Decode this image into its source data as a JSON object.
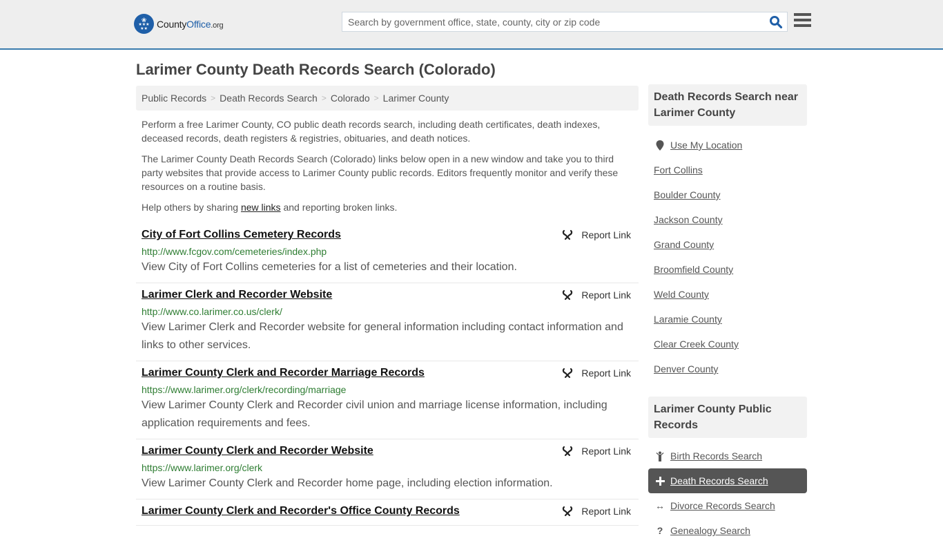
{
  "header": {
    "logo": {
      "county": "County",
      "office": "Office",
      "org": ".org"
    },
    "search_placeholder": "Search by government office, state, county, city or zip code",
    "search_value": ""
  },
  "page": {
    "title": "Larimer County Death Records Search (Colorado)",
    "breadcrumb": [
      "Public Records",
      "Death Records Search",
      "Colorado",
      "Larimer County"
    ],
    "intro": {
      "p1": "Perform a free Larimer County, CO public death records search, including death certificates, death indexes, deceased records, death registers & registries, obituaries, and death notices.",
      "p2": "The Larimer County Death Records Search (Colorado) links below open in a new window and take you to third party websites that provide access to Larimer County public records. Editors frequently monitor and verify these resources on a routine basis.",
      "p3_before": "Help others by sharing ",
      "p3_link": "new links",
      "p3_after": " and reporting broken links."
    }
  },
  "results": [
    {
      "title": "City of Fort Collins Cemetery Records",
      "url": "http://www.fcgov.com/cemeteries/index.php",
      "description": "View City of Fort Collins cemeteries for a list of cemeteries and their location.",
      "report": "Report Link"
    },
    {
      "title": "Larimer Clerk and Recorder Website",
      "url": "http://www.co.larimer.co.us/clerk/",
      "description": "View Larimer Clerk and Recorder website for general information including contact information and links to other services.",
      "report": "Report Link"
    },
    {
      "title": "Larimer County Clerk and Recorder Marriage Records",
      "url": "https://www.larimer.org/clerk/recording/marriage",
      "description": "View Larimer County Clerk and Recorder civil union and marriage license information, including application requirements and fees.",
      "report": "Report Link"
    },
    {
      "title": "Larimer County Clerk and Recorder Website",
      "url": "https://www.larimer.org/clerk",
      "description": "View Larimer County Clerk and Recorder home page, including election information.",
      "report": "Report Link"
    },
    {
      "title": "Larimer County Clerk and Recorder's Office County Records",
      "url": "",
      "description": "",
      "report": "Report Link"
    }
  ],
  "sidebar": {
    "nearby_heading": "Death Records Search near Larimer County",
    "use_location": "Use My Location",
    "nearby": [
      "Fort Collins",
      "Boulder County",
      "Jackson County",
      "Grand County",
      "Broomfield County",
      "Weld County",
      "Laramie County",
      "Clear Creek County",
      "Denver County"
    ],
    "public_heading": "Larimer County Public Records",
    "public_records": [
      {
        "label": "Birth Records Search",
        "icon": "child-icon",
        "active": false
      },
      {
        "label": "Death Records Search",
        "icon": "plus-icon",
        "active": true
      },
      {
        "label": "Divorce Records Search",
        "icon": "arrows-horizontal-icon",
        "active": false
      },
      {
        "label": "Genealogy Search",
        "icon": "question-icon",
        "active": false
      }
    ]
  },
  "colors": {
    "brand_blue": "#1f5fa8",
    "header_border": "#3a7bad",
    "url_green": "#2e7d32",
    "active_bg": "#555555"
  }
}
